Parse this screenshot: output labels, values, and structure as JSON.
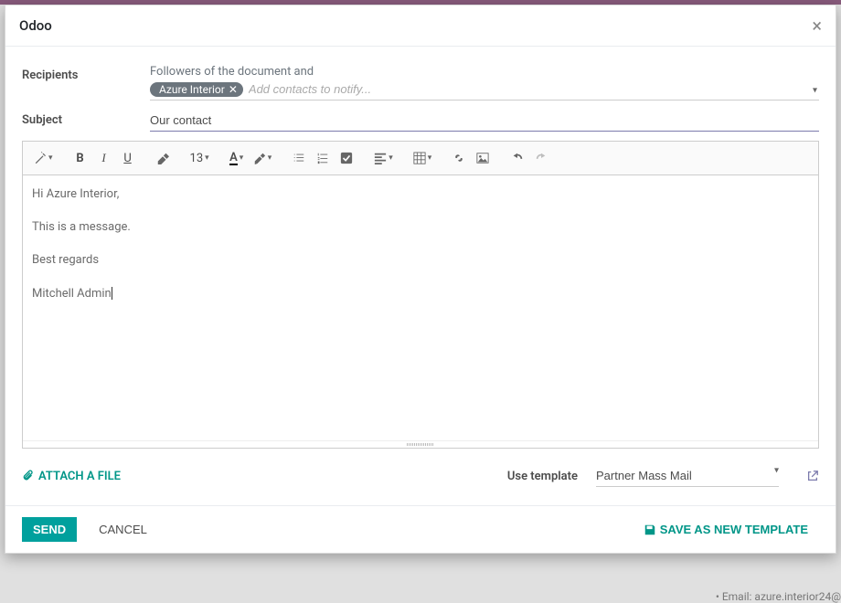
{
  "modal": {
    "title": "Odoo"
  },
  "form": {
    "recipients_label": "Recipients",
    "recipients_prefix": "Followers of the document and",
    "recipient_tags": [
      "Azure Interior"
    ],
    "recipients_placeholder": "Add contacts to notify...",
    "subject_label": "Subject",
    "subject_value": "Our contact"
  },
  "toolbar": {
    "font_size": "13"
  },
  "editor": {
    "lines": [
      "Hi Azure Interior,",
      "This is a message.",
      "Best regards",
      "Mitchell Admin"
    ]
  },
  "attach": {
    "label": "ATTACH A FILE"
  },
  "template": {
    "label": "Use template",
    "selected": "Partner Mass Mail"
  },
  "footer": {
    "send": "SEND",
    "cancel": "CANCEL",
    "save_template": "SAVE AS NEW TEMPLATE"
  },
  "background": {
    "snippet": "• Email: azure.interior24@"
  }
}
